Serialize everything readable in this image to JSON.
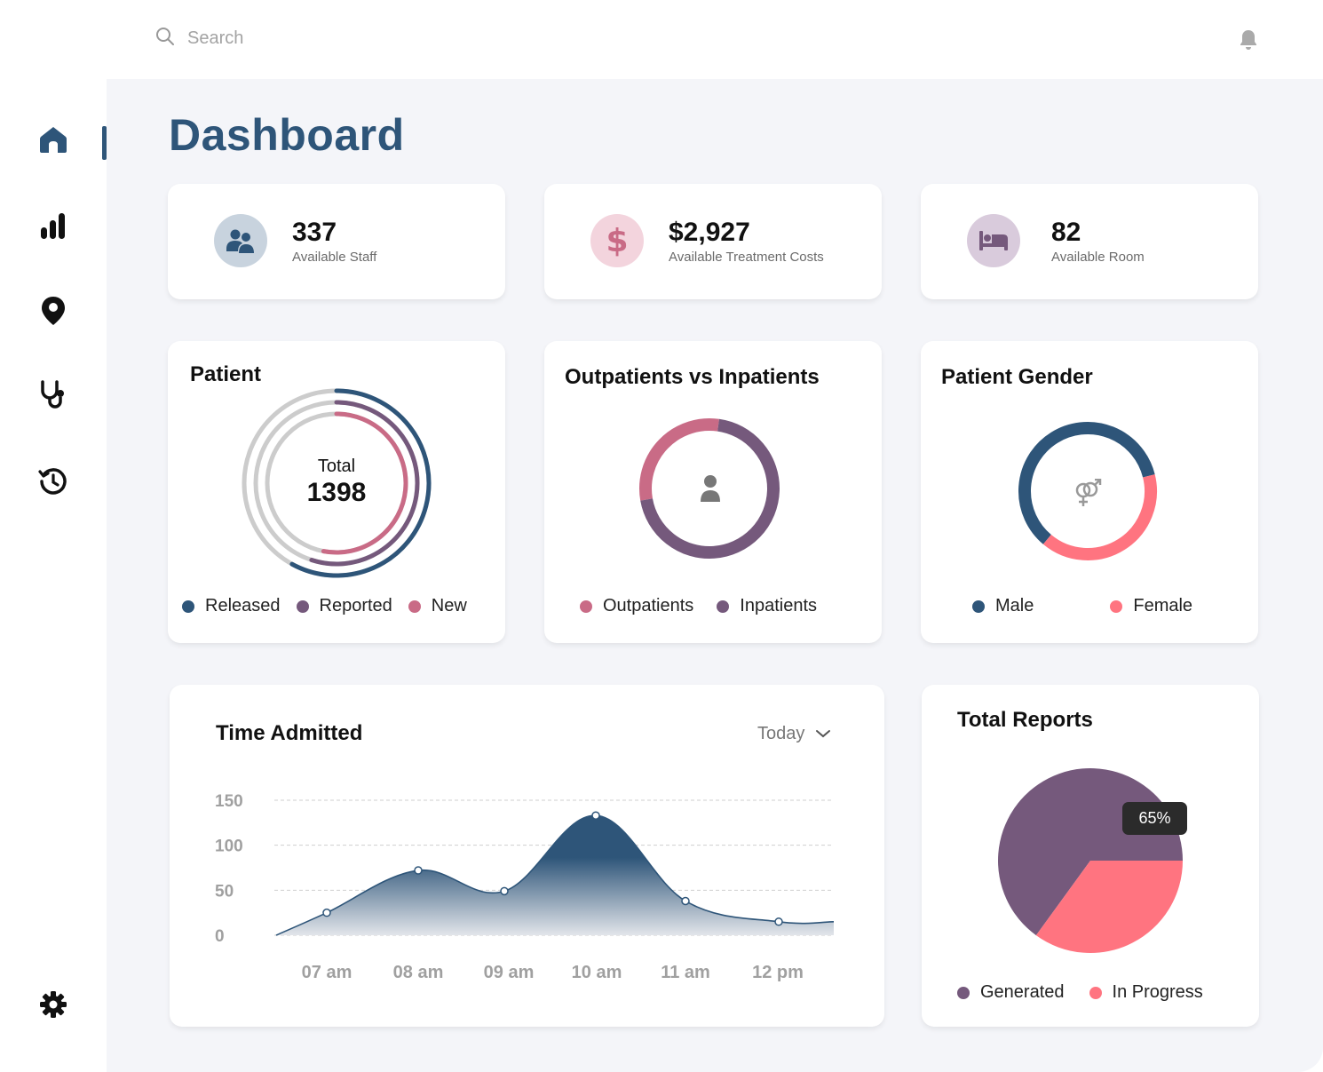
{
  "search": {
    "placeholder": "Search"
  },
  "header": {
    "notifications_icon": "bell-icon"
  },
  "sidebar": {
    "items": [
      {
        "name": "home",
        "icon": "home-icon",
        "active": true
      },
      {
        "name": "analytics",
        "icon": "bar-chart-icon",
        "active": false
      },
      {
        "name": "location",
        "icon": "location-pin-icon",
        "active": false
      },
      {
        "name": "doctors",
        "icon": "stethoscope-icon",
        "active": false
      },
      {
        "name": "history",
        "icon": "history-icon",
        "active": false
      }
    ],
    "settings_icon": "gear-icon"
  },
  "page": {
    "title": "Dashboard"
  },
  "stats": [
    {
      "value": "337",
      "label": "Available Staff",
      "icon": "staff-icon",
      "color": "#2e5579",
      "bg": "#c8d3de"
    },
    {
      "value": "$2,927",
      "label": "Available Treatment Costs",
      "icon": "dollar-icon",
      "color": "#c96b86",
      "bg": "#f3d4dd"
    },
    {
      "value": "82",
      "label": "Available Room",
      "icon": "bed-icon",
      "color": "#75597c",
      "bg": "#d9cbdc"
    }
  ],
  "colors": {
    "primary": "#2e5579",
    "purple": "#75597c",
    "pink": "#c96b86",
    "coral": "#ff7480",
    "grey_ring": "#cccccc"
  },
  "patient": {
    "title": "Patient",
    "total_label": "Total",
    "total_value": "1398",
    "legend": [
      "Released",
      "Reported",
      "New"
    ]
  },
  "outpatients": {
    "title": "Outpatients vs Inpatients",
    "legend": [
      "Outpatients",
      "Inpatients"
    ]
  },
  "gender": {
    "title": "Patient Gender",
    "legend": [
      "Male",
      "Female"
    ]
  },
  "time_admitted": {
    "title": "Time Admitted",
    "dropdown_value": "Today"
  },
  "reports": {
    "title": "Total Reports",
    "tooltip": "65%",
    "legend": [
      "Generated",
      "In Progress"
    ]
  },
  "chart_data": [
    {
      "type": "pie",
      "title": "Patient",
      "categories": [
        "Released",
        "Reported",
        "New"
      ],
      "values": [
        0.58,
        0.55,
        0.53
      ],
      "colors": [
        "#2e5579",
        "#75597c",
        "#c96b86"
      ]
    },
    {
      "type": "pie",
      "title": "Outpatients vs Inpatients",
      "categories": [
        "Outpatients",
        "Inpatients"
      ],
      "values": [
        0.3,
        0.7
      ],
      "colors": [
        "#c96b86",
        "#75597c"
      ]
    },
    {
      "type": "pie",
      "title": "Patient Gender",
      "categories": [
        "Male",
        "Female"
      ],
      "values": [
        0.6,
        0.4
      ],
      "colors": [
        "#2e5579",
        "#ff7480"
      ]
    },
    {
      "type": "area",
      "title": "Time Admitted",
      "categories": [
        "07 am",
        "08 am",
        "09 am",
        "10 am",
        "11 am",
        "12 pm"
      ],
      "values": [
        25,
        72,
        49,
        133,
        38,
        15
      ],
      "yticks": [
        0,
        50,
        100,
        150
      ],
      "ylim": [
        0,
        150
      ],
      "grid": true,
      "color": "#2e5579"
    },
    {
      "type": "pie",
      "title": "Total Reports",
      "categories": [
        "Generated",
        "In Progress"
      ],
      "values": [
        65,
        35
      ],
      "colors": [
        "#75597c",
        "#ff7480"
      ]
    }
  ]
}
